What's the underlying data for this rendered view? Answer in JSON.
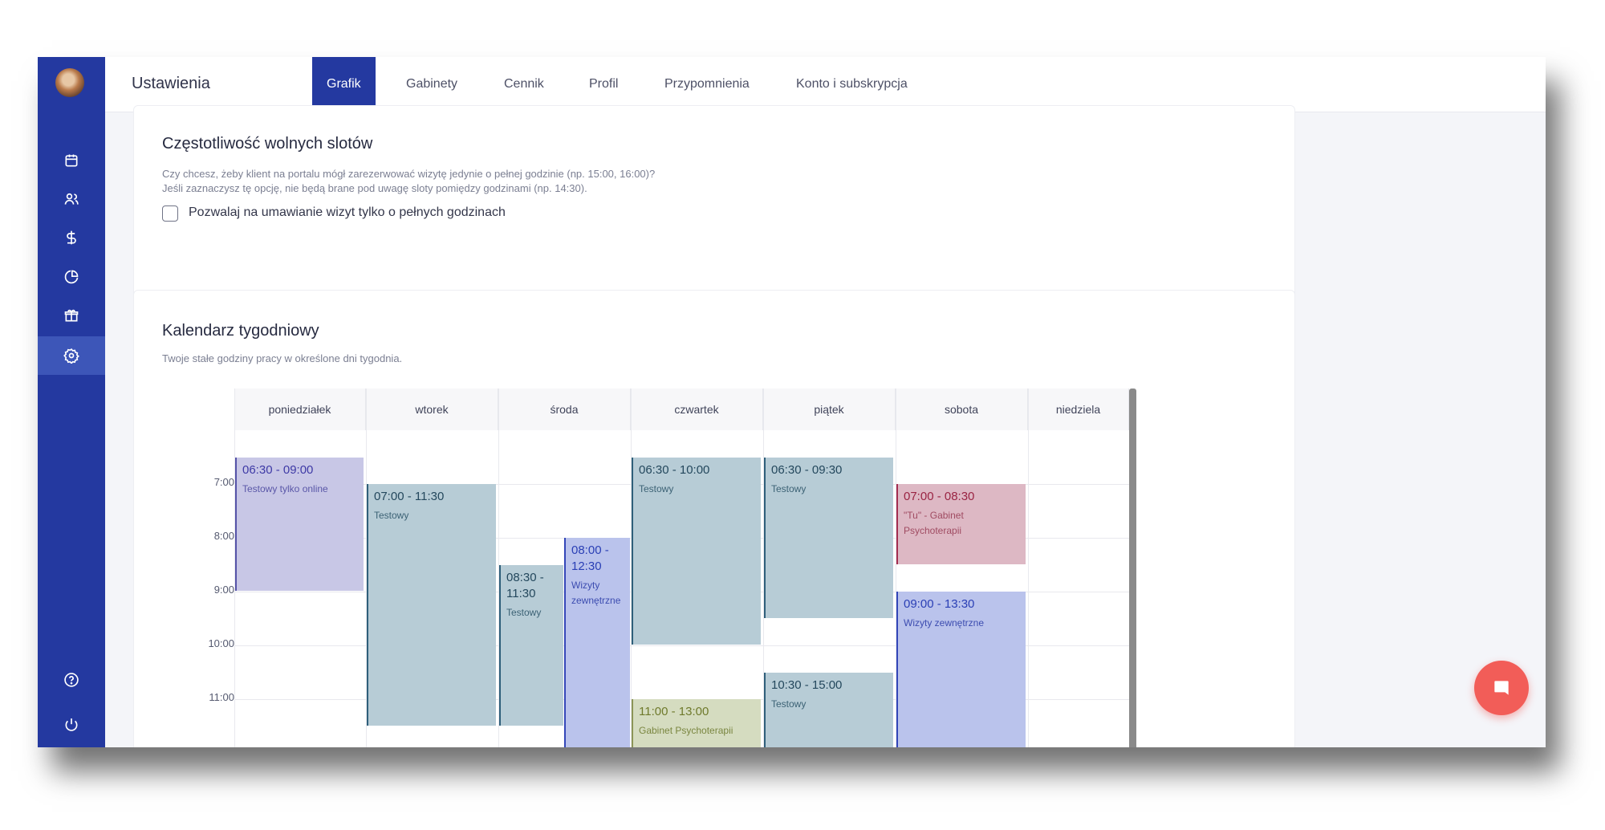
{
  "page": {
    "title": "Ustawienia"
  },
  "tabs": [
    {
      "label": "Grafik",
      "active": true
    },
    {
      "label": "Gabinety"
    },
    {
      "label": "Cennik"
    },
    {
      "label": "Profil"
    },
    {
      "label": "Przypomnienia"
    },
    {
      "label": "Konto i subskrypcja"
    }
  ],
  "sidebar": {
    "items": [
      {
        "icon": "calendar-icon"
      },
      {
        "icon": "users-icon"
      },
      {
        "icon": "dollar-icon"
      },
      {
        "icon": "pie-chart-icon"
      },
      {
        "icon": "gift-icon"
      },
      {
        "icon": "gear-icon",
        "active": true
      }
    ],
    "bottom": [
      {
        "icon": "help-icon"
      },
      {
        "icon": "power-icon"
      }
    ]
  },
  "slots": {
    "title": "Częstotliwość wolnych slotów",
    "desc1": "Czy chcesz, żeby klient na portalu mógł zarezerwować wizytę jedynie o pełnej godzinie (np. 15:00, 16:00)?",
    "desc2": "Jeśli zaznaczysz tę opcję, nie będą brane pod uwagę sloty pomiędzy godzinami (np. 14:30).",
    "checkbox_label": "Pozwalaj na umawianie wizyt tylko o pełnych godzinach",
    "checked": false
  },
  "calendar": {
    "title": "Kalendarz tygodniowy",
    "desc": "Twoje stałe godziny pracy w określone dni tygodnia.",
    "days": [
      "poniedziałek",
      "wtorek",
      "środa",
      "czwartek",
      "piątek",
      "sobota",
      "niedziela"
    ],
    "hours": [
      "7:00",
      "8:00",
      "9:00",
      "10:00",
      "11:00"
    ],
    "events": [
      {
        "day": 0,
        "start": 6.5,
        "end": 9.0,
        "time": "06:30 - 09:00",
        "label": "Testowy tylko online",
        "kind": "lavender"
      },
      {
        "day": 1,
        "start": 7.0,
        "end": 11.5,
        "time": "07:00 - 11:30",
        "label": "Testowy",
        "kind": "gray"
      },
      {
        "day": 2,
        "start": 8.5,
        "end": 11.5,
        "time": "08:30 - 11:30",
        "label": "Testowy",
        "kind": "gray",
        "half": "left"
      },
      {
        "day": 2,
        "start": 8.0,
        "end": 12.5,
        "time": "08:00 - 12:30",
        "label": "Wizyty zewnętrzne",
        "kind": "blue",
        "half": "right"
      },
      {
        "day": 3,
        "start": 6.5,
        "end": 10.0,
        "time": "06:30 - 10:00",
        "label": "Testowy",
        "kind": "gray"
      },
      {
        "day": 3,
        "start": 11.0,
        "end": 13.0,
        "time": "11:00 - 13:00",
        "label": "Gabinet Psychoterapii",
        "kind": "olive"
      },
      {
        "day": 4,
        "start": 6.5,
        "end": 9.5,
        "time": "06:30 - 09:30",
        "label": "Testowy",
        "kind": "gray"
      },
      {
        "day": 4,
        "start": 10.5,
        "end": 15.0,
        "time": "10:30 - 15:00",
        "label": "Testowy",
        "kind": "gray"
      },
      {
        "day": 5,
        "start": 7.0,
        "end": 8.5,
        "time": "07:00 - 08:30",
        "label": "\"Tu\" - Gabinet Psychoterapii",
        "kind": "pink"
      },
      {
        "day": 5,
        "start": 9.0,
        "end": 13.5,
        "time": "09:00 - 13:30",
        "label": "Wizyty zewnętrzne",
        "kind": "blue"
      }
    ]
  },
  "colors": {
    "sidebar": "#2439a0",
    "accent": "#2439a0",
    "chat": "#f25d58"
  }
}
